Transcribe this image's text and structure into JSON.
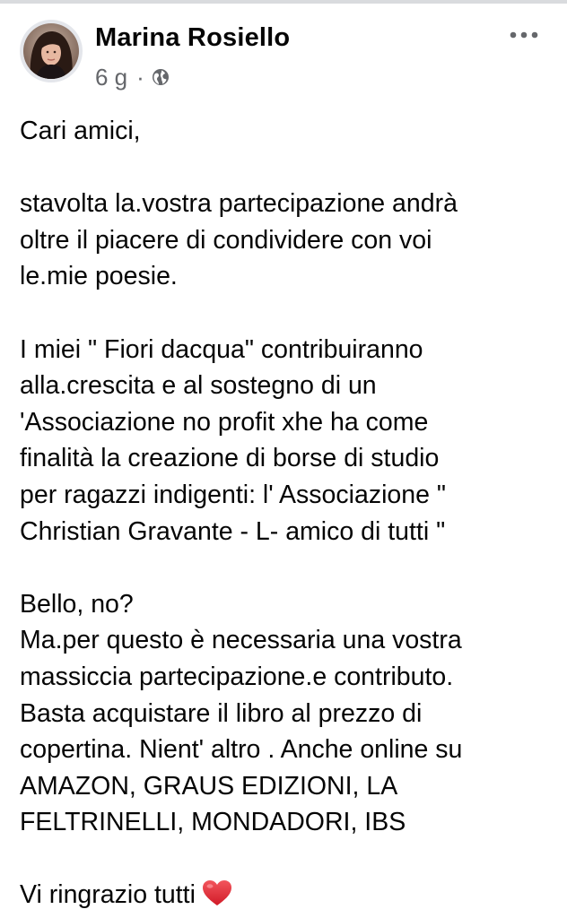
{
  "colors": {
    "text_primary": "#050505",
    "text_secondary": "#65676b",
    "avatar_ring": "#e4e6eb",
    "heart": "#e0242f"
  },
  "post": {
    "author": "Marina Rosiello",
    "timestamp": "6 g",
    "separator": "·",
    "audience_icon": "globe-icon",
    "more_icon": "more-horizontal-icon",
    "body": {
      "p1": [
        "Cari amici,"
      ],
      "p2": [
        "stavolta la.vostra partecipazione andrà",
        "oltre il piacere di condividere con voi",
        "le.mie poesie."
      ],
      "p3": [
        "I miei \" Fiori dacqua\" contribuiranno",
        "alla.crescita e al sostegno di un",
        "'Associazione no profit xhe ha come",
        "finalità la creazione di borse di studio",
        "per ragazzi indigenti: l' Associazione \"",
        "Christian Gravante - L- amico di tutti \""
      ],
      "p4": [
        "Bello, no?",
        "Ma.per questo è necessaria una vostra",
        "massiccia partecipazione.e  contributo.",
        "Basta acquistare il libro al prezzo di",
        "copertina. Nient' altro . Anche online su",
        "AMAZON, GRAUS EDIZIONI, LA",
        "FELTRINELLI,  MONDADORI,  IBS"
      ],
      "p5": [
        "Vi ringrazio tutti"
      ],
      "closing_emoji": "red-heart-emoji"
    }
  }
}
